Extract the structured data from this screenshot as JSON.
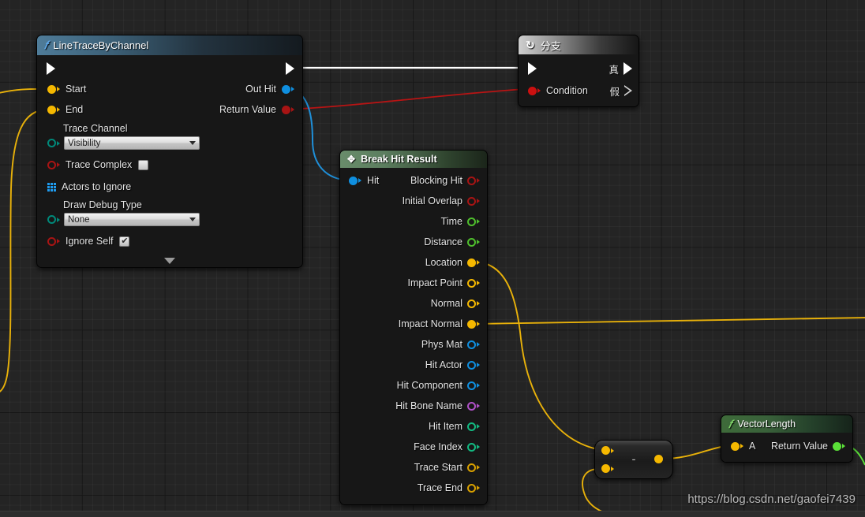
{
  "canvas": {
    "watermark": "https://blog.csdn.net/gaofei7439",
    "background_color": "#242424",
    "grid_minor_color": "#2e2e2e",
    "grid_major_color": "#121212"
  },
  "nodes": {
    "line_trace": {
      "title": "LineTraceByChannel",
      "icon": "function-f-icon",
      "header_color": "#4f7c99",
      "exec_in_label": "",
      "exec_out_label": "",
      "inputs": [
        {
          "label": "Start",
          "pin_style": "solid",
          "pin_color": "#f5b800"
        },
        {
          "label": "End",
          "pin_style": "solid",
          "pin_color": "#f5b800"
        }
      ],
      "outputs": [
        {
          "label": "Out Hit",
          "pin_style": "solid",
          "pin_color": "#0f8fe0"
        },
        {
          "label": "Return Value",
          "pin_style": "solid",
          "pin_color": "#a81414"
        }
      ],
      "trace_channel": {
        "label": "Trace Channel",
        "value": "Visibility",
        "pin_color": "#00897a"
      },
      "trace_complex": {
        "label": "Trace Complex",
        "checked": false,
        "pin_color": "#a81414"
      },
      "actors_to_ignore": {
        "label": "Actors to Ignore",
        "pin_color": "#1f9cf0"
      },
      "draw_debug_type": {
        "label": "Draw Debug Type",
        "value": "None",
        "pin_color": "#00897a"
      },
      "ignore_self": {
        "label": "Ignore Self",
        "checked": true,
        "checkmark": "✔",
        "pin_color": "#a81414"
      },
      "collapse_icon": "chevron-down-icon"
    },
    "branch": {
      "title": "分支",
      "icon": "branch-icon",
      "true_label": "真",
      "false_label": "假",
      "condition_label": "Condition",
      "condition_pin_color": "#cc1010"
    },
    "break_hit_result": {
      "title": "Break Hit Result",
      "icon": "break-struct-icon",
      "header_color": "#698c6b",
      "input": {
        "label": "Hit",
        "pin_color": "#0f8fe0",
        "pin_style": "solid"
      },
      "outputs": [
        {
          "label": "Blocking Hit",
          "pin_color": "#a81414",
          "pin_style": "hollow"
        },
        {
          "label": "Initial Overlap",
          "pin_color": "#a81414",
          "pin_style": "hollow"
        },
        {
          "label": "Time",
          "pin_color": "#4fbf2d",
          "pin_style": "hollow"
        },
        {
          "label": "Distance",
          "pin_color": "#4fbf2d",
          "pin_style": "hollow"
        },
        {
          "label": "Location",
          "pin_color": "#f5b800",
          "pin_style": "solid"
        },
        {
          "label": "Impact Point",
          "pin_color": "#f5b800",
          "pin_style": "hollow"
        },
        {
          "label": "Normal",
          "pin_color": "#f5b800",
          "pin_style": "hollow"
        },
        {
          "label": "Impact Normal",
          "pin_color": "#f5b800",
          "pin_style": "solid"
        },
        {
          "label": "Phys Mat",
          "pin_color": "#0f8fe0",
          "pin_style": "hollow"
        },
        {
          "label": "Hit Actor",
          "pin_color": "#0f8fe0",
          "pin_style": "hollow"
        },
        {
          "label": "Hit Component",
          "pin_color": "#0f8fe0",
          "pin_style": "hollow"
        },
        {
          "label": "Hit Bone Name",
          "pin_color": "#b050c8",
          "pin_style": "hollow"
        },
        {
          "label": "Hit Item",
          "pin_color": "#13b981",
          "pin_style": "hollow"
        },
        {
          "label": "Face Index",
          "pin_color": "#13b981",
          "pin_style": "hollow"
        },
        {
          "label": "Trace Start",
          "pin_color": "#d8a000",
          "pin_style": "hollow"
        },
        {
          "label": "Trace End",
          "pin_color": "#d8a000",
          "pin_style": "hollow"
        }
      ]
    },
    "subtract": {
      "operator": "-",
      "input_a_pin_color": "#f5b800",
      "input_b_pin_color": "#f5b800",
      "output_pin_color": "#f5b800"
    },
    "vector_length": {
      "title": "VectorLength",
      "icon": "function-f-icon",
      "header_color": "#698c6b",
      "input": {
        "label": "A",
        "pin_color": "#f5b800"
      },
      "output": {
        "label": "Return Value",
        "pin_color": "#5ae038"
      }
    }
  },
  "wires": {
    "exec_color": "#ffffff",
    "hit_color": "#1f8fd8",
    "bool_color": "#b81414",
    "vector_color": "#e8b10a",
    "float_color": "#5ae038"
  }
}
